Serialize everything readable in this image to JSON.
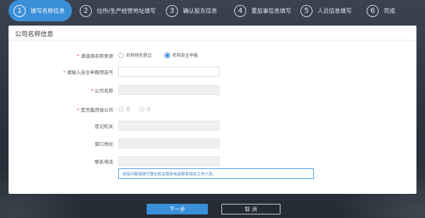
{
  "steps": [
    {
      "num": "1",
      "label": "填写名称信息"
    },
    {
      "num": "2",
      "label": "住所/生产经营地址填写"
    },
    {
      "num": "3",
      "label": "确认股东信息"
    },
    {
      "num": "4",
      "label": "董监事信息填写"
    },
    {
      "num": "5",
      "label": "人员信息填写"
    },
    {
      "num": "6",
      "label": "完成"
    }
  ],
  "active_step": 1,
  "panel": {
    "title": "公司名称信息",
    "name_source_label": "请选择名称来源",
    "name_source_options": [
      "名称预先登记",
      "名称自主申报"
    ],
    "name_source_selected": "名称自主申报",
    "self_declare_label": "请输入自主申报预选号",
    "self_declare_value": "",
    "company_name_label": "公司名称",
    "company_name_value": "",
    "is_group_label": "是否集团母公司",
    "is_group_options": [
      "是",
      "否"
    ],
    "registration_authority_label": "登记机关",
    "registration_authority_value": "",
    "window_address_label": "窗口地址",
    "window_address_value": "",
    "contact_phone_label": "联系电话",
    "contact_phone_value": "",
    "hint_text": "如有问题请拨打登记机关联系电话联系相关工作人员。"
  },
  "buttons": {
    "next": "下一步",
    "cancel": "取 消"
  },
  "colors": {
    "accent": "#3a8fd9",
    "required": "#e64a3c",
    "background": "#2b3440"
  }
}
